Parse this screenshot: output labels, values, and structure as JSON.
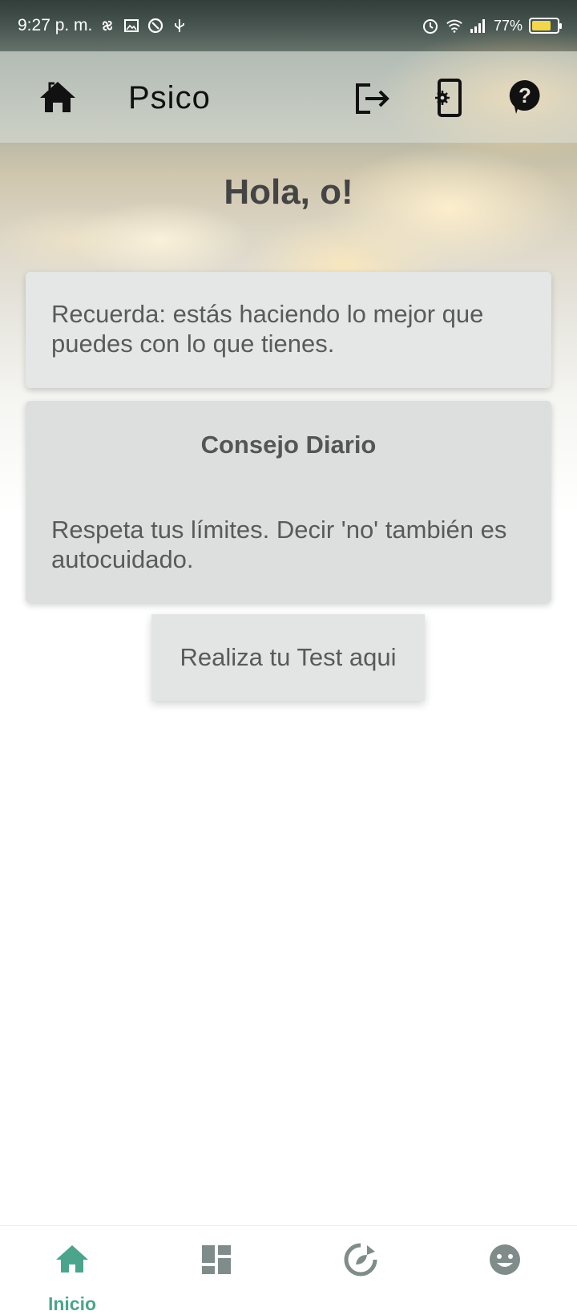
{
  "status_bar": {
    "time": "9:27 p. m.",
    "battery": "77%",
    "battery_level": 0.77
  },
  "app_bar": {
    "title": "Psico",
    "icons": [
      "home-icon",
      "logout-icon",
      "phone-settings-icon",
      "help-icon"
    ]
  },
  "greeting": "Hola, o!",
  "quote": "Recuerda: estás haciendo lo mejor que puedes con lo que tienes.",
  "tip": {
    "title": "Consejo Diario",
    "text": "Respeta tus límites. Decir 'no' también es autocuidado."
  },
  "test_button": "Realiza tu Test aqui",
  "bottom_nav": {
    "items": [
      {
        "label": "Inicio",
        "icon": "home-icon",
        "active": true
      },
      {
        "label": "",
        "icon": "dashboard-icon",
        "active": false
      },
      {
        "label": "",
        "icon": "recycle-icon",
        "active": false
      },
      {
        "label": "",
        "icon": "smiley-icon",
        "active": false
      }
    ],
    "active_color": "#4aa58c",
    "inactive_color": "#7f8c8a"
  }
}
